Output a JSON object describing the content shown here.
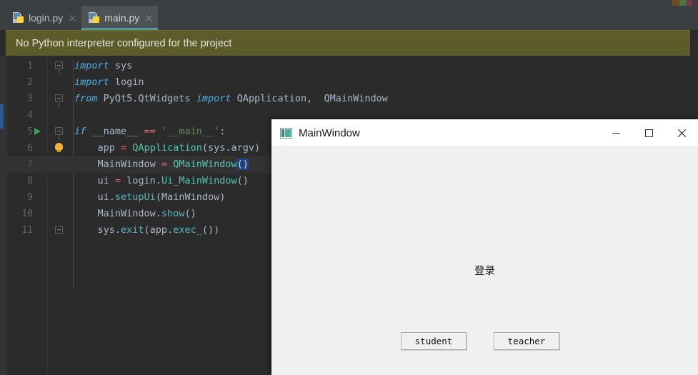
{
  "ide": {
    "tabs": [
      {
        "label": "login.py",
        "icon": "python-file-icon",
        "active": false,
        "close_icon": "close-icon"
      },
      {
        "label": "main.py",
        "icon": "python-file-icon",
        "active": true,
        "close_icon": "close-icon"
      }
    ],
    "banner": {
      "text": "No Python interpreter configured for the project",
      "background": "#5b5c2a",
      "text_color": "#e6e6dc"
    },
    "editor": {
      "background": "#2b2b2b",
      "current_line": 7,
      "gutter": {
        "run_marker_line": 5,
        "bulb_marker_line": 6,
        "fold_lines": [
          1,
          3,
          5,
          11
        ]
      },
      "lines": [
        {
          "no": "1",
          "tokens": [
            {
              "t": "import",
              "c": "kw"
            },
            {
              "t": " sys",
              "c": "id"
            }
          ]
        },
        {
          "no": "2",
          "tokens": [
            {
              "t": "import",
              "c": "kw"
            },
            {
              "t": " login",
              "c": "id"
            }
          ]
        },
        {
          "no": "3",
          "tokens": [
            {
              "t": "from",
              "c": "kw"
            },
            {
              "t": " PyQt5.QtWidgets ",
              "c": "id"
            },
            {
              "t": "import",
              "c": "kw"
            },
            {
              "t": " QApplication,  QMainWindow",
              "c": "id"
            }
          ]
        },
        {
          "no": "4",
          "tokens": []
        },
        {
          "no": "5",
          "tokens": [
            {
              "t": "if",
              "c": "kw"
            },
            {
              "t": " __name__ ",
              "c": "id"
            },
            {
              "t": "==",
              "c": "eq"
            },
            {
              "t": " ",
              "c": "id"
            },
            {
              "t": "'__main__'",
              "c": "str"
            },
            {
              "t": ":",
              "c": "id"
            }
          ]
        },
        {
          "no": "6",
          "tokens": [
            {
              "t": "    app ",
              "c": "id"
            },
            {
              "t": "=",
              "c": "eq"
            },
            {
              "t": " ",
              "c": "id"
            },
            {
              "t": "QApplication",
              "c": "call"
            },
            {
              "t": "(sys.argv)",
              "c": "id"
            }
          ]
        },
        {
          "no": "7",
          "tokens": [
            {
              "t": "    MainWindow ",
              "c": "id"
            },
            {
              "t": "=",
              "c": "eq"
            },
            {
              "t": " ",
              "c": "id"
            },
            {
              "t": "QMainWindow",
              "c": "call"
            },
            {
              "t": "()",
              "c": "sel"
            }
          ]
        },
        {
          "no": "8",
          "tokens": [
            {
              "t": "    ui ",
              "c": "id"
            },
            {
              "t": "=",
              "c": "eq"
            },
            {
              "t": " login.",
              "c": "id"
            },
            {
              "t": "Ui_MainWindow",
              "c": "call"
            },
            {
              "t": "()",
              "c": "id"
            }
          ]
        },
        {
          "no": "9",
          "tokens": [
            {
              "t": "    ui.",
              "c": "id"
            },
            {
              "t": "setupUi",
              "c": "fn"
            },
            {
              "t": "(MainWindow)",
              "c": "id"
            }
          ]
        },
        {
          "no": "10",
          "tokens": [
            {
              "t": "    MainWindow.",
              "c": "id"
            },
            {
              "t": "show",
              "c": "fn"
            },
            {
              "t": "()",
              "c": "id"
            }
          ]
        },
        {
          "no": "11",
          "tokens": [
            {
              "t": "    sys.",
              "c": "id"
            },
            {
              "t": "exit",
              "c": "fn"
            },
            {
              "t": "(app.",
              "c": "id"
            },
            {
              "t": "exec_",
              "c": "fn"
            },
            {
              "t": "())",
              "c": "id"
            }
          ]
        }
      ]
    }
  },
  "dialog": {
    "title": "MainWindow",
    "icon": "app-window-icon",
    "controls": {
      "minimize_label": "minimize-icon",
      "maximize_label": "maximize-icon",
      "close_label": "close-icon"
    },
    "heading": "登录",
    "buttons": [
      {
        "label": "student"
      },
      {
        "label": "teacher"
      }
    ],
    "background": "#f0f0f0",
    "titlebar_background": "#ffffff"
  }
}
